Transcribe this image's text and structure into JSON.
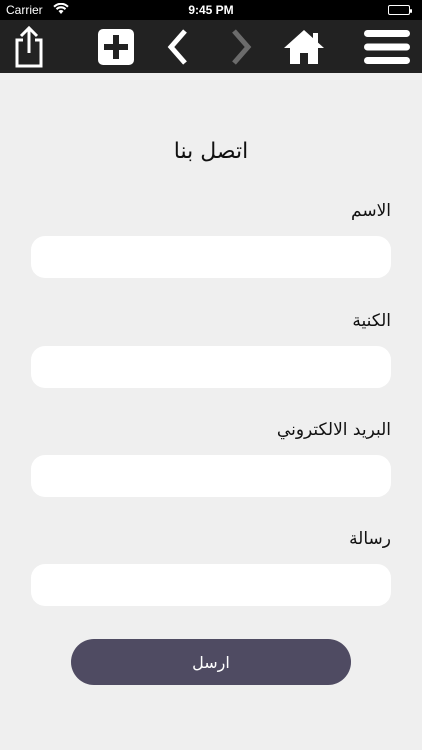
{
  "status": {
    "carrier": "Carrier",
    "time": "9:45 PM"
  },
  "toolbar": {
    "icons": [
      "share-icon",
      "add-icon",
      "back-icon",
      "forward-icon",
      "home-icon",
      "menu-icon"
    ],
    "accent": "#ffffff",
    "disabled_color": "#6b6b6b",
    "background": "#222222"
  },
  "form": {
    "title": "اتصل بنا",
    "name_label": "الاسم",
    "surname_label": "الكنية",
    "email_label": "البريد الالكتروني",
    "message_label": "رسالة",
    "submit_label": "ارسل",
    "submit_color": "#4f4b62"
  }
}
